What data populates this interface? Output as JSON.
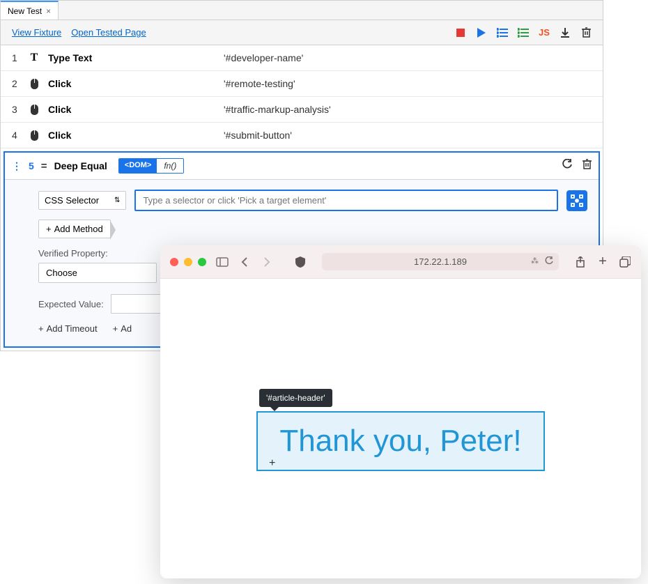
{
  "tab": {
    "title": "New Test",
    "close": "×"
  },
  "links": {
    "viewFixture": "View Fixture",
    "openTested": "Open Tested Page"
  },
  "toolbar": {
    "stop": "stop",
    "play": "play",
    "stepList": "step-list",
    "stepListCheck": "step-list-check",
    "js": "JS",
    "download": "download",
    "delete": "delete"
  },
  "steps": [
    {
      "num": "1",
      "icon": "T",
      "name": "Type Text",
      "target": "'#developer-name'"
    },
    {
      "num": "2",
      "icon": "mouse",
      "name": "Click",
      "target": "'#remote-testing'"
    },
    {
      "num": "3",
      "icon": "mouse",
      "name": "Click",
      "target": "'#traffic-markup-analysis'"
    },
    {
      "num": "4",
      "icon": "mouse",
      "name": "Click",
      "target": "'#submit-button'"
    }
  ],
  "active": {
    "num": "5",
    "name": "Deep Equal",
    "pillDom": "<DOM>",
    "pillFn": "fn()",
    "selectorType": "CSS Selector",
    "selectorPlaceholder": "Type a selector or click 'Pick a target element'",
    "addMethod": "Add Method",
    "verifiedLabel": "Verified Property:",
    "choose": "Choose",
    "expectedLabel": "Expected Value:",
    "addTimeout": "Add Timeout",
    "addMsg": "Ad"
  },
  "browser": {
    "address": "172.22.1.189",
    "tooltip": "'#article-header'",
    "headline": "Thank you, Peter!"
  }
}
